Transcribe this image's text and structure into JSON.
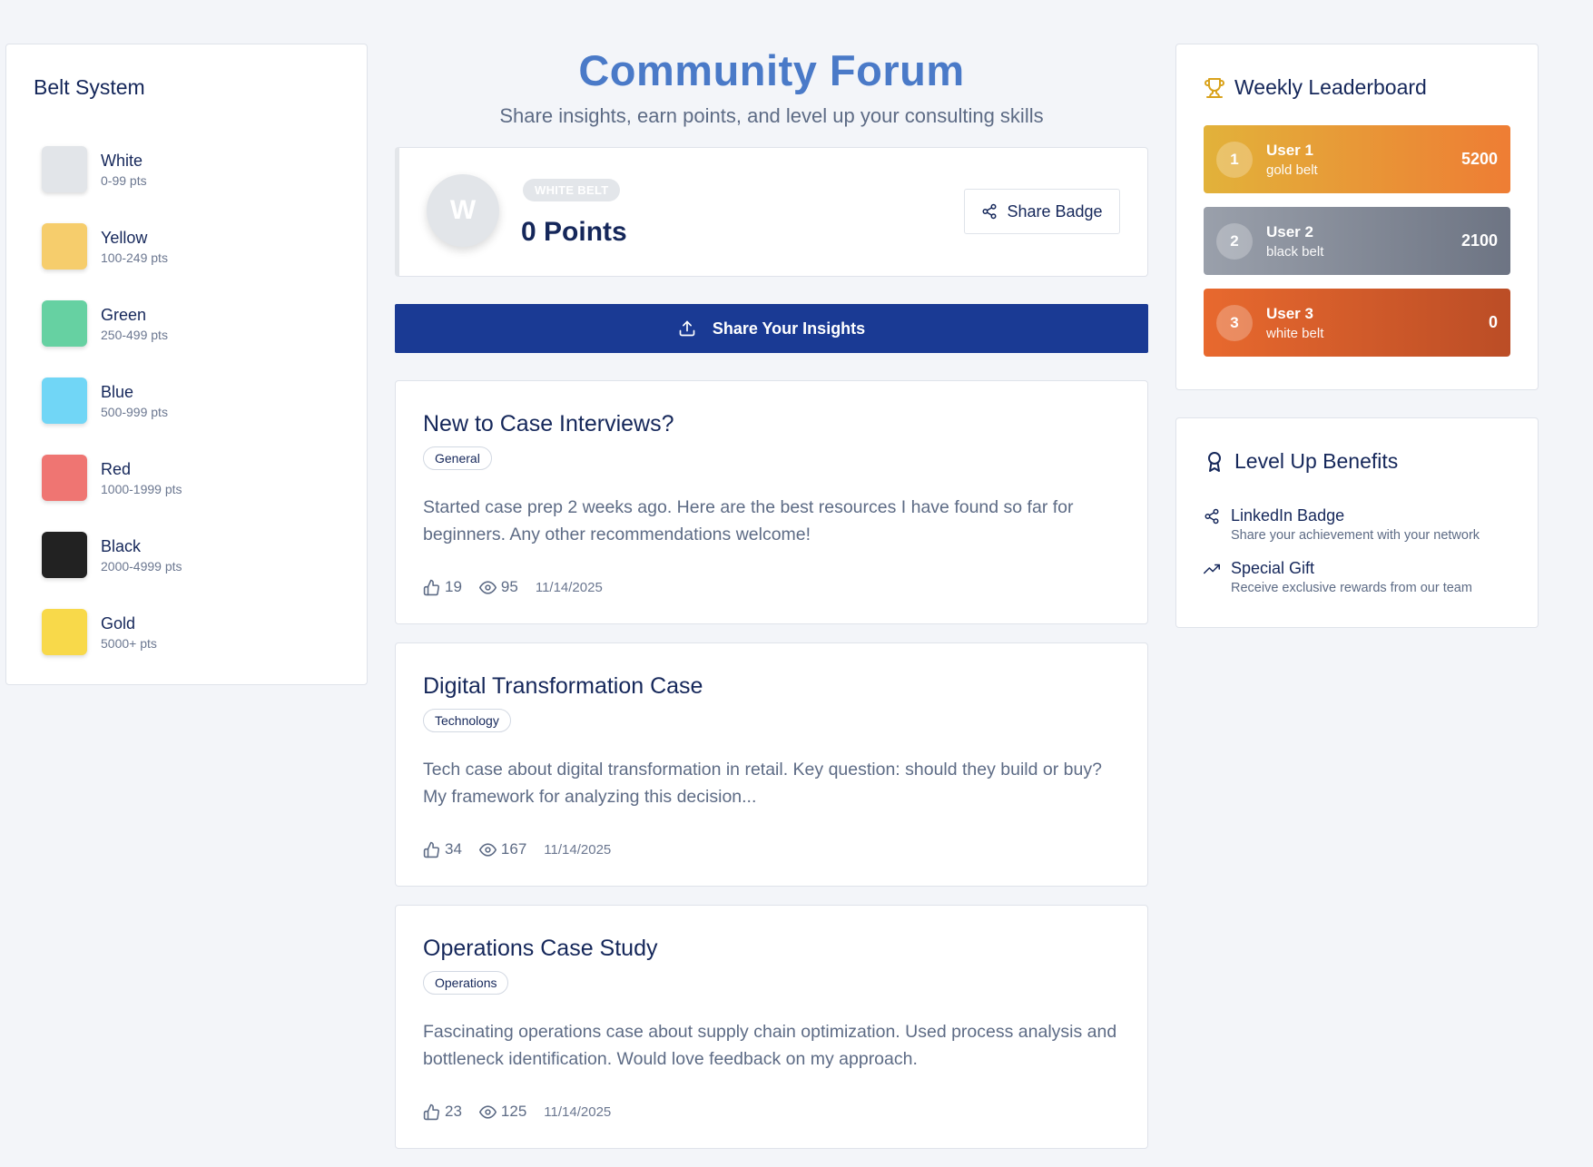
{
  "belt_system": {
    "title": "Belt System",
    "belts": [
      {
        "name": "White",
        "range": "0-99 pts",
        "color": "#e2e5e9"
      },
      {
        "name": "Yellow",
        "range": "100-249 pts",
        "color": "#f6cd6c"
      },
      {
        "name": "Green",
        "range": "250-499 pts",
        "color": "#66d1a2"
      },
      {
        "name": "Blue",
        "range": "500-999 pts",
        "color": "#71d6f6"
      },
      {
        "name": "Red",
        "range": "1000-1999 pts",
        "color": "#ef7572"
      },
      {
        "name": "Black",
        "range": "2000-4999 pts",
        "color": "#222222"
      },
      {
        "name": "Gold",
        "range": "5000+ pts",
        "color": "#f8d94a"
      }
    ]
  },
  "header": {
    "title": "Community Forum",
    "subtitle": "Share insights, earn points, and level up your consulting skills"
  },
  "profile": {
    "avatar_initial": "W",
    "belt_label": "WHITE BELT",
    "points": "0 Points",
    "share_badge_label": "Share Badge"
  },
  "share_insights_label": "Share Your Insights",
  "posts": [
    {
      "title": "New to Case Interviews?",
      "tag": "General",
      "body": "Started case prep 2 weeks ago. Here are the best resources I have found so far for beginners. Any other recommendations welcome!",
      "likes": "19",
      "views": "95",
      "date": "11/14/2025"
    },
    {
      "title": "Digital Transformation Case",
      "tag": "Technology",
      "body": "Tech case about digital transformation in retail. Key question: should they build or buy? My framework for analyzing this decision...",
      "likes": "34",
      "views": "167",
      "date": "11/14/2025"
    },
    {
      "title": "Operations Case Study",
      "tag": "Operations",
      "body": "Fascinating operations case about supply chain optimization. Used process analysis and bottleneck identification. Would love feedback on my approach.",
      "likes": "23",
      "views": "125",
      "date": "11/14/2025"
    }
  ],
  "leaderboard": {
    "title": "Weekly Leaderboard",
    "entries": [
      {
        "rank": "1",
        "name": "User 1",
        "belt": "gold belt",
        "score": "5200",
        "gradient_from": "#e2b23a",
        "gradient_to": "#ee7d34"
      },
      {
        "rank": "2",
        "name": "User 2",
        "belt": "black belt",
        "score": "2100",
        "gradient_from": "#9aa0ab",
        "gradient_to": "#6d7483"
      },
      {
        "rank": "3",
        "name": "User 3",
        "belt": "white belt",
        "score": "0",
        "gradient_from": "#e8692e",
        "gradient_to": "#bb4d26"
      }
    ]
  },
  "benefits": {
    "title": "Level Up Benefits",
    "items": [
      {
        "title": "LinkedIn Badge",
        "desc": "Share your achievement with your network",
        "icon": "share-icon"
      },
      {
        "title": "Special Gift",
        "desc": "Receive exclusive rewards from our team",
        "icon": "trending-up-icon"
      }
    ]
  },
  "colors": {
    "accent_title": "#4a7ac8",
    "primary_button": "#1a3a94",
    "trophy": "#d9a21b",
    "text_dark": "#15275a"
  }
}
